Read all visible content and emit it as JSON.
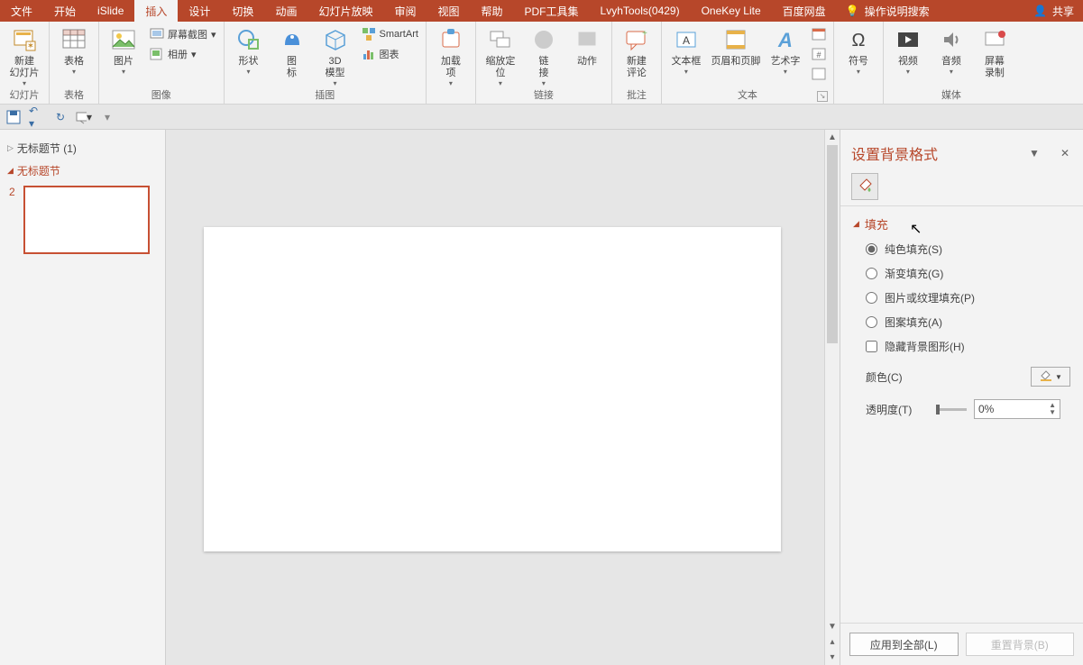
{
  "tabs": {
    "file": "文件",
    "home": "开始",
    "islide": "iSlide",
    "insert": "插入",
    "design": "设计",
    "transition": "切换",
    "animation": "动画",
    "slideshow": "幻灯片放映",
    "review": "审阅",
    "view": "视图",
    "help": "帮助",
    "pdf": "PDF工具集",
    "lvyh": "LvyhTools(0429)",
    "onekey": "OneKey Lite",
    "baidu": "百度网盘",
    "tellme": "操作说明搜索",
    "share": "共享"
  },
  "ribbon": {
    "newslide": "新建\n幻灯片",
    "slides_group": "幻灯片",
    "table": "表格",
    "table_group": "表格",
    "picture": "图片",
    "screenshot": "屏幕截图",
    "album": "相册",
    "image_group": "图像",
    "shape": "形状",
    "icon": "图\n标",
    "model": "3D\n模型",
    "smartart": "SmartArt",
    "chart": "图表",
    "illus_group": "插图",
    "addin": "加载\n项",
    "zoom": "缩放定\n位",
    "link": "链\n接",
    "action": "动作",
    "link_group": "链接",
    "comment": "新建\n评论",
    "comment_group": "批注",
    "textbox": "文本框",
    "headerfooter": "页眉和页脚",
    "wordart": "艺术字",
    "text_group": "文本",
    "symbol": "符号",
    "video": "视频",
    "audio": "音频",
    "record": "屏幕\n录制",
    "media_group": "媒体"
  },
  "thumbs": {
    "section1": "无标题节 (1)",
    "section2": "无标题节",
    "slide_num": "2"
  },
  "pane": {
    "title": "设置背景格式",
    "fill_section": "填充",
    "solid": "纯色填充(S)",
    "gradient": "渐变填充(G)",
    "pictex": "图片或纹理填充(P)",
    "pattern": "图案填充(A)",
    "hidebg": "隐藏背景图形(H)",
    "color_label": "颜色(C)",
    "trans_label": "透明度(T)",
    "trans_val": "0%",
    "apply_all": "应用到全部(L)",
    "reset": "重置背景(B)"
  }
}
